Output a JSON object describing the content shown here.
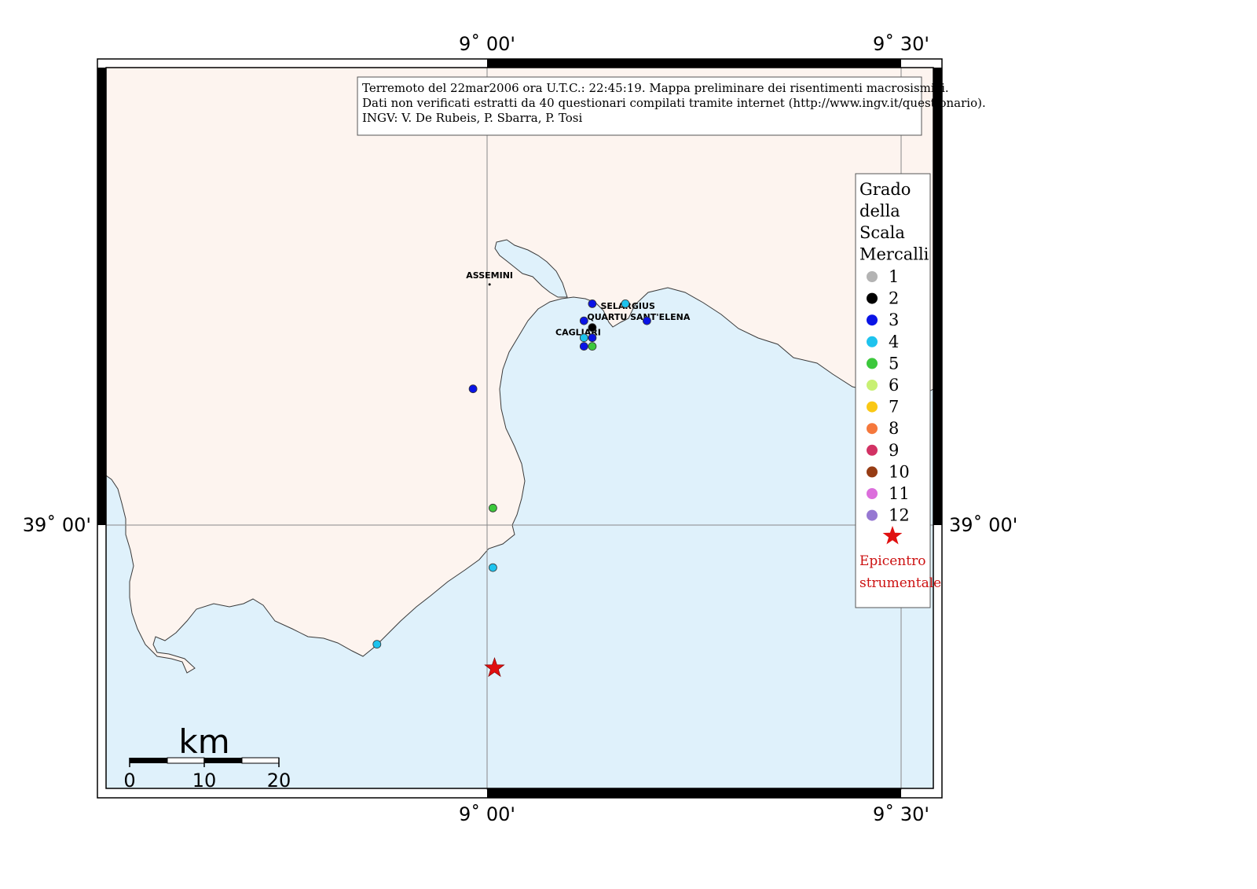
{
  "graticule": {
    "top_labels": [
      "9˚ 00'",
      "9˚ 30'"
    ],
    "bottom_labels": [
      "9˚ 00'",
      "9˚ 30'"
    ],
    "left_label": "39˚ 00'",
    "right_label": "39˚ 00'"
  },
  "info_box": {
    "line1": "Terremoto del 22mar2006 ora U.T.C.: 22:45:19.  Mappa preliminare dei risentimenti macrosismici.",
    "line2": "Dati non verificati estratti da 40 questionari compilati tramite internet (http://www.ingv.it/questionario).",
    "line3": "INGV: V.  De Rubeis, P.  Sbarra, P.  Tosi"
  },
  "places": [
    {
      "name": "ASSEMINI",
      "lon": 9.003,
      "lat": 39.29
    },
    {
      "name": "SELARGIUS",
      "lon": 9.17,
      "lat": 39.254
    },
    {
      "name": "QUARTU SANT'ELENA",
      "lon": 9.183,
      "lat": 39.241
    },
    {
      "name": "CAGLIARI",
      "lon": 9.11,
      "lat": 39.223
    }
  ],
  "legend": {
    "title": [
      "Grado",
      "della",
      "Scala",
      "Mercalli"
    ],
    "grades": [
      {
        "label": "1",
        "color": "#b3b3b3"
      },
      {
        "label": "2",
        "color": "#000000"
      },
      {
        "label": "3",
        "color": "#0a14e6"
      },
      {
        "label": "4",
        "color": "#1ec3ee"
      },
      {
        "label": "5",
        "color": "#3cc83c"
      },
      {
        "label": "6",
        "color": "#c8f073"
      },
      {
        "label": "7",
        "color": "#fac814"
      },
      {
        "label": "8",
        "color": "#f5783c"
      },
      {
        "label": "9",
        "color": "#d23264"
      },
      {
        "label": "10",
        "color": "#963c14"
      },
      {
        "label": "11",
        "color": "#dc6edc"
      },
      {
        "label": "12",
        "color": "#9678d2"
      }
    ],
    "epicenter_line1": "Epicentro",
    "epicenter_line2": "strumentale"
  },
  "observations": [
    {
      "lon": 9.127,
      "lat": 39.26,
      "grade": 3
    },
    {
      "lon": 9.167,
      "lat": 39.26,
      "grade": 4
    },
    {
      "lon": 9.117,
      "lat": 39.24,
      "grade": 3
    },
    {
      "lon": 9.127,
      "lat": 39.232,
      "grade": 2
    },
    {
      "lon": 9.193,
      "lat": 39.24,
      "grade": 3
    },
    {
      "lon": 9.117,
      "lat": 39.22,
      "grade": 4
    },
    {
      "lon": 9.127,
      "lat": 39.22,
      "grade": 3
    },
    {
      "lon": 9.117,
      "lat": 39.21,
      "grade": 3
    },
    {
      "lon": 9.127,
      "lat": 39.21,
      "grade": 5
    },
    {
      "lon": 8.983,
      "lat": 39.16,
      "grade": 3
    },
    {
      "lon": 9.007,
      "lat": 39.02,
      "grade": 5
    },
    {
      "lon": 9.007,
      "lat": 38.95,
      "grade": 4
    },
    {
      "lon": 8.867,
      "lat": 38.86,
      "grade": 4
    }
  ],
  "epicenter": {
    "lon": 9.009,
    "lat": 38.832
  },
  "scale_bar": {
    "title": "km",
    "ticks": [
      "0",
      "10",
      "20"
    ]
  },
  "colors": {
    "land": "#fdf4ef",
    "sea": "#dff1fb",
    "coast": "#3a3a3a",
    "grid": "#888888",
    "star": "#e01010"
  }
}
